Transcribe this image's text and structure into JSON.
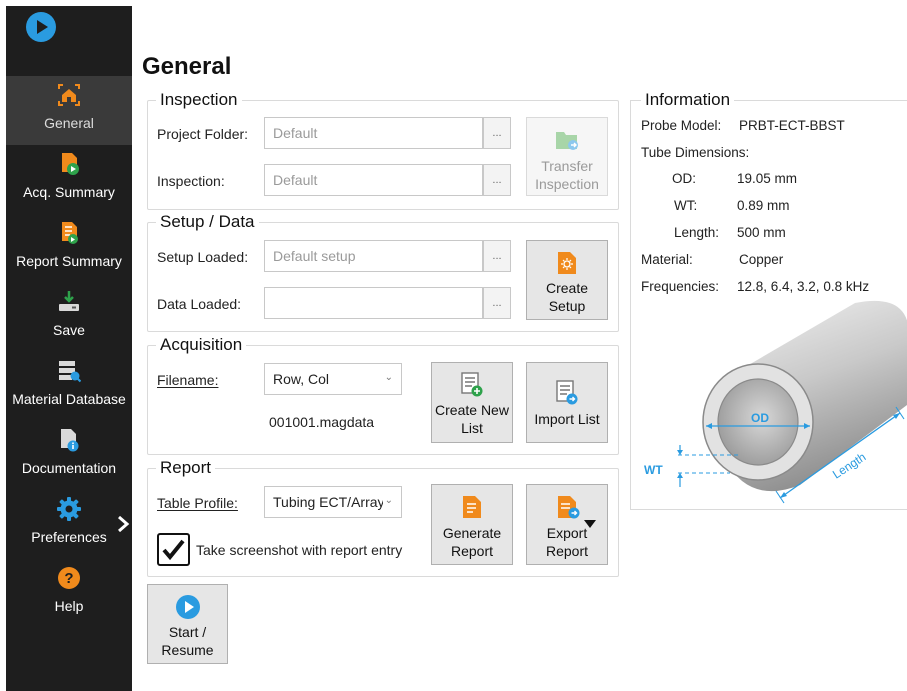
{
  "sidebar": {
    "items": [
      {
        "label": "General",
        "icon": "home-icon",
        "active": true
      },
      {
        "label": "Acq. Summary",
        "icon": "document-play-icon"
      },
      {
        "label": "Report Summary",
        "icon": "report-list-icon"
      },
      {
        "label": "Save",
        "icon": "download-drive-icon"
      },
      {
        "label": "Material Database",
        "icon": "database-search-icon"
      },
      {
        "label": "Documentation",
        "icon": "document-info-icon"
      },
      {
        "label": "Preferences",
        "icon": "gear-icon"
      },
      {
        "label": "Help",
        "icon": "question-icon"
      }
    ],
    "accent": "#2a9be0",
    "orange": "#f08a1c"
  },
  "page": {
    "title": "General"
  },
  "inspection": {
    "title": "Inspection",
    "project_folder_label": "Project Folder:",
    "project_folder_value": "Default",
    "inspection_label": "Inspection:",
    "inspection_value": "Default",
    "browse": "...",
    "transfer_label_1": "Transfer",
    "transfer_label_2": "Inspection"
  },
  "setup": {
    "title": "Setup / Data",
    "setup_loaded_label": "Setup Loaded:",
    "setup_loaded_value": "Default setup",
    "data_loaded_label": "Data Loaded:",
    "data_loaded_value": "",
    "browse": "...",
    "create_label_1": "Create",
    "create_label_2": "Setup"
  },
  "acquisition": {
    "title": "Acquisition",
    "filename_label": "Filename:",
    "filename_select": "Row, Col",
    "filename_value": "001001.magdata",
    "create_list_1": "Create New",
    "create_list_2": "List",
    "import_list": "Import List"
  },
  "report": {
    "title": "Report",
    "table_profile_label": "Table Profile:",
    "table_profile_value": "Tubing ECT/Array",
    "screenshot_label": "Take screenshot with report entry",
    "screenshot_checked": true,
    "generate_1": "Generate",
    "generate_2": "Report",
    "export_1": "Export",
    "export_2": "Report"
  },
  "start": {
    "label_1": "Start /",
    "label_2": "Resume"
  },
  "information": {
    "title": "Information",
    "probe_model_label": "Probe Model:",
    "probe_model_value": "PRBT-ECT-BBST",
    "tube_dimensions_label": "Tube Dimensions:",
    "od_label": "OD:",
    "od_value": "19.05 mm",
    "wt_label": "WT:",
    "wt_value": "0.89 mm",
    "length_label": "Length:",
    "length_value": "500 mm",
    "material_label": "Material:",
    "material_value": "Copper",
    "frequencies_label": "Frequencies:",
    "frequencies_value": "12.8, 6.4, 3.2, 0.8 kHz",
    "diagram_od": "OD",
    "diagram_wt": "WT",
    "diagram_length": "Length"
  }
}
